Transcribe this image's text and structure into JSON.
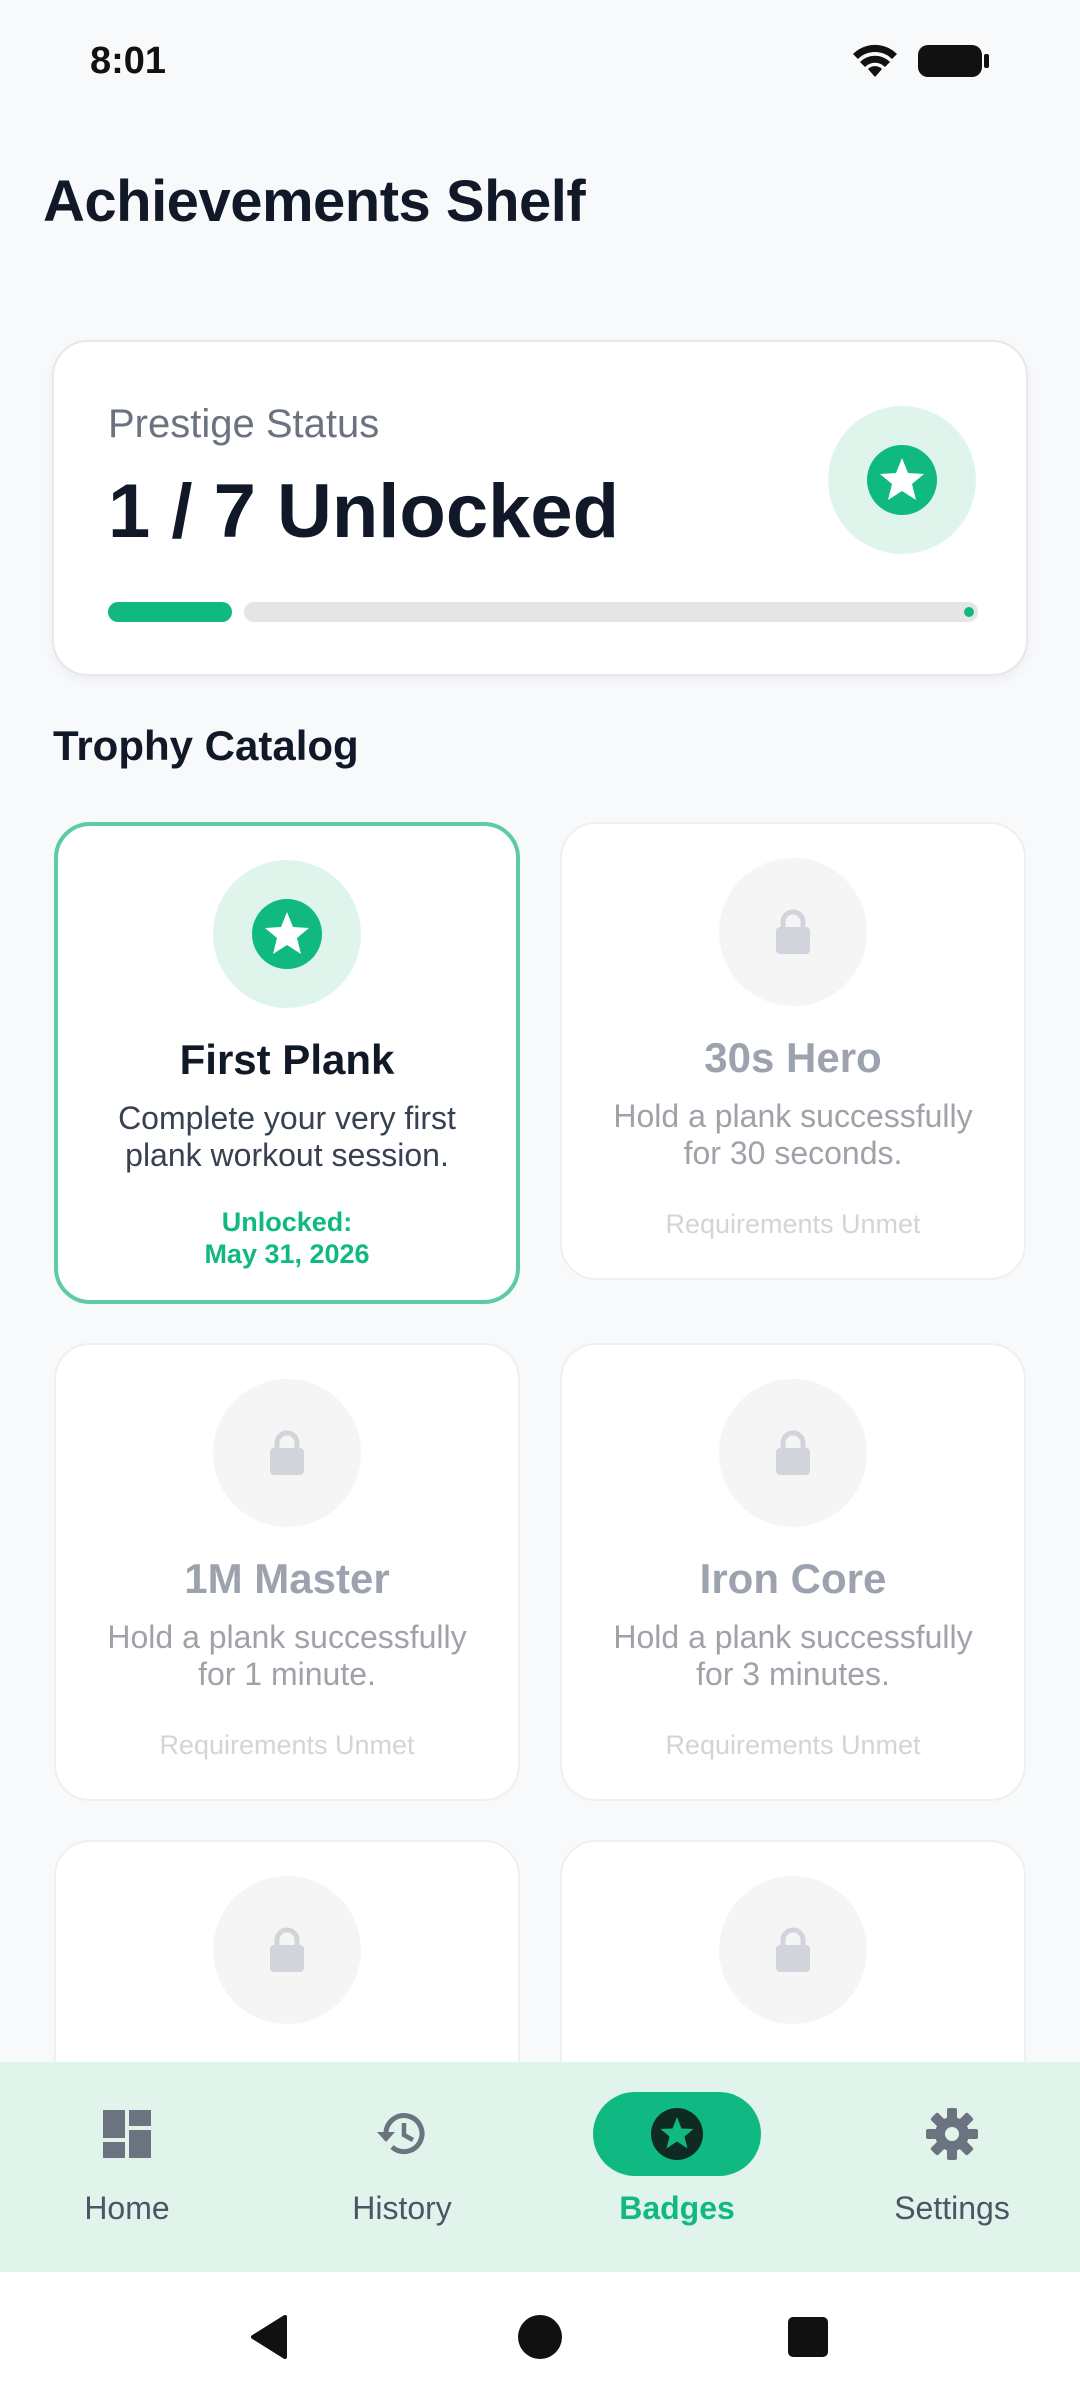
{
  "status_bar": {
    "time": "8:01"
  },
  "header": {
    "title": "Achievements Shelf"
  },
  "prestige": {
    "label": "Prestige Status",
    "value": "1 / 7 Unlocked",
    "progress": 0.1429
  },
  "catalog": {
    "title": "Trophy Catalog",
    "trophies": [
      {
        "name": "First Plank",
        "description": "Complete your very first plank workout session.",
        "status": "Unlocked:\nMay 31, 2026",
        "unlocked": true
      },
      {
        "name": "30s Hero",
        "description": "Hold a plank successfully for 30 seconds.",
        "status": "Requirements Unmet",
        "unlocked": false
      },
      {
        "name": "1M Master",
        "description": "Hold a plank successfully for 1 minute.",
        "status": "Requirements Unmet",
        "unlocked": false
      },
      {
        "name": "Iron Core",
        "description": "Hold a plank successfully for 3 minutes.",
        "status": "Requirements Unmet",
        "unlocked": false
      },
      {
        "name": "",
        "description": "",
        "status": "",
        "unlocked": false
      },
      {
        "name": "",
        "description": "",
        "status": "",
        "unlocked": false
      }
    ]
  },
  "bottom_nav": {
    "items": [
      {
        "label": "Home",
        "icon": "dashboard-icon",
        "active": false
      },
      {
        "label": "History",
        "icon": "history-icon",
        "active": false
      },
      {
        "label": "Badges",
        "icon": "star-badge-icon",
        "active": true
      },
      {
        "label": "Settings",
        "icon": "gear-icon",
        "active": false
      }
    ]
  },
  "colors": {
    "accent": "#10B981",
    "accent_light": "#DFF5EC",
    "nav_bg": "#E1F4EC",
    "background": "#F8F9FB"
  }
}
